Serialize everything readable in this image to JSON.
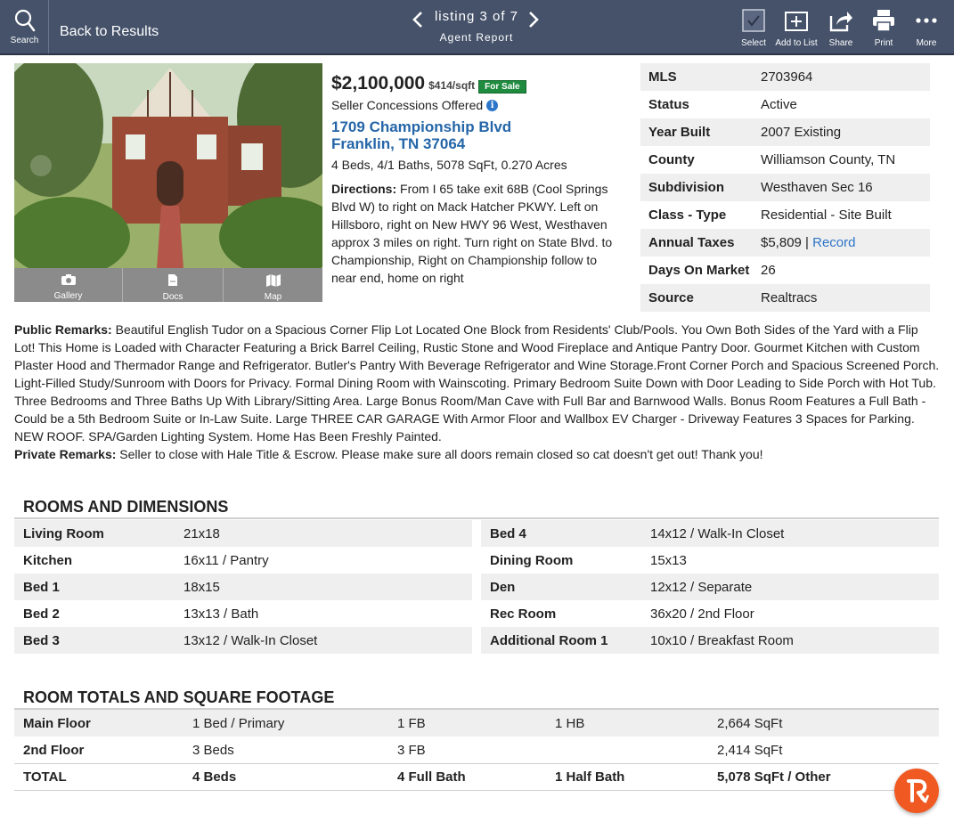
{
  "topbar": {
    "search_label": "Search",
    "back_label": "Back to Results",
    "listing_label": "listing 3 of 7",
    "sub_label": "Agent Report",
    "actions": [
      {
        "icon": "checkbox-icon",
        "label": "Select"
      },
      {
        "icon": "add-to-list-icon",
        "label": "Add to List"
      },
      {
        "icon": "share-icon",
        "label": "Share"
      },
      {
        "icon": "print-icon",
        "label": "Print"
      },
      {
        "icon": "more-icon",
        "label": "More"
      }
    ]
  },
  "photo_bar": {
    "gallery_label": "Gallery",
    "docs_label": "Docs",
    "map_label": "Map"
  },
  "listing": {
    "price": "$2,100,000",
    "price_per_sqft": "$414/sqft",
    "status_badge": "For Sale",
    "concessions": "Seller Concessions Offered",
    "address_number": "1709",
    "address_street": "Championship Blvd",
    "address_city": "Franklin, TN 37064",
    "specs": "4 Beds, 4/1 Baths, 5078 SqFt, 0.270 Acres",
    "directions_label": "Directions:",
    "directions": "From I 65 take exit 68B (Cool Springs Blvd W) to right on Mack Hatcher PKWY. Left on Hillsboro, right on New HWY 96 West, Westhaven approx 3 miles on right. Turn right on State Blvd. to Championship, Right on Championship follow to near end, home on right"
  },
  "facts": [
    {
      "label": "MLS",
      "value": "2703964"
    },
    {
      "label": "Status",
      "value": "Active"
    },
    {
      "label": "Year Built",
      "value": "2007 Existing"
    },
    {
      "label": "County",
      "value": "Williamson County, TN"
    },
    {
      "label": "Subdivision",
      "value": "Westhaven Sec 16"
    },
    {
      "label": "Class - Type",
      "value": "Residential - Site Built"
    },
    {
      "label": "Annual Taxes",
      "value": "$5,809",
      "link": "Record"
    },
    {
      "label": "Days On Market",
      "value": "26"
    },
    {
      "label": "Source",
      "value": "Realtracs"
    }
  ],
  "remarks": {
    "public_label": "Public Remarks:",
    "public": "Beautiful English Tudor on a Spacious Corner Flip Lot Located One Block from Residents' Club/Pools. You Own Both Sides of the Yard with a Flip Lot! This Home is Loaded with Character Featuring a Brick Barrel Ceiling, Rustic Stone and Wood Fireplace and Antique Pantry Door. Gourmet Kitchen with Custom Plaster Hood and Thermador Range and Refrigerator. Butler's Pantry With Beverage Refrigerator and Wine Storage.Front Corner Porch and Spacious Screened Porch. Light-Filled Study/Sunroom with Doors for Privacy. Formal Dining Room with Wainscoting. Primary Bedroom Suite Down with Door Leading to Side Porch with Hot Tub. Three Bedrooms and Three Baths Up With Library/Sitting Area. Large Bonus Room/Man Cave with Full Bar and Barnwood Walls. Bonus Room Features a Full Bath - Could be a 5th Bedroom Suite or In-Law Suite. Large THREE CAR GARAGE With Armor Floor and Wallbox EV Charger - Driveway Features 3 Spaces for Parking. NEW ROOF. SPA/Garden Lighting System. Home Has Been Freshly Painted.",
    "private_label": "Private Remarks:",
    "private": "Seller to close with Hale Title & Escrow. Please make sure all doors remain closed so cat doesn't get out! Thank you!"
  },
  "rooms": {
    "title": "ROOMS AND DIMENSIONS",
    "left": [
      {
        "name": "Living Room",
        "value": "21x18"
      },
      {
        "name": "Kitchen",
        "value": "16x11 / Pantry"
      },
      {
        "name": "Bed 1",
        "value": "18x15"
      },
      {
        "name": "Bed 2",
        "value": "13x13 / Bath"
      },
      {
        "name": "Bed 3",
        "value": "13x12 / Walk-In Closet"
      }
    ],
    "right": [
      {
        "name": "Bed 4",
        "value": "14x12 / Walk-In Closet"
      },
      {
        "name": "Dining Room",
        "value": "15x13"
      },
      {
        "name": "Den",
        "value": "12x12 / Separate"
      },
      {
        "name": "Rec Room",
        "value": "36x20 / 2nd Floor"
      },
      {
        "name": "Additional Room 1",
        "value": "10x10 / Breakfast Room"
      }
    ]
  },
  "totals": {
    "title": "ROOM TOTALS AND SQUARE FOOTAGE",
    "rows": [
      {
        "floor": "Main Floor",
        "beds": "1 Bed / Primary",
        "full": "1 FB",
        "half": "1 HB",
        "sqft": "2,664 SqFt"
      },
      {
        "floor": "2nd Floor",
        "beds": "3 Beds",
        "full": "3 FB",
        "half": "",
        "sqft": "2,414 SqFt"
      },
      {
        "floor": "TOTAL",
        "beds": "4 Beds",
        "full": "4 Full Bath",
        "half": "1 Half Bath",
        "sqft": "5,078 SqFt / Other"
      }
    ]
  },
  "colors": {
    "topbar": "#45526a",
    "link": "#2566a8",
    "for_sale_badge": "#1f8b3f",
    "fab": "#f05a22"
  }
}
